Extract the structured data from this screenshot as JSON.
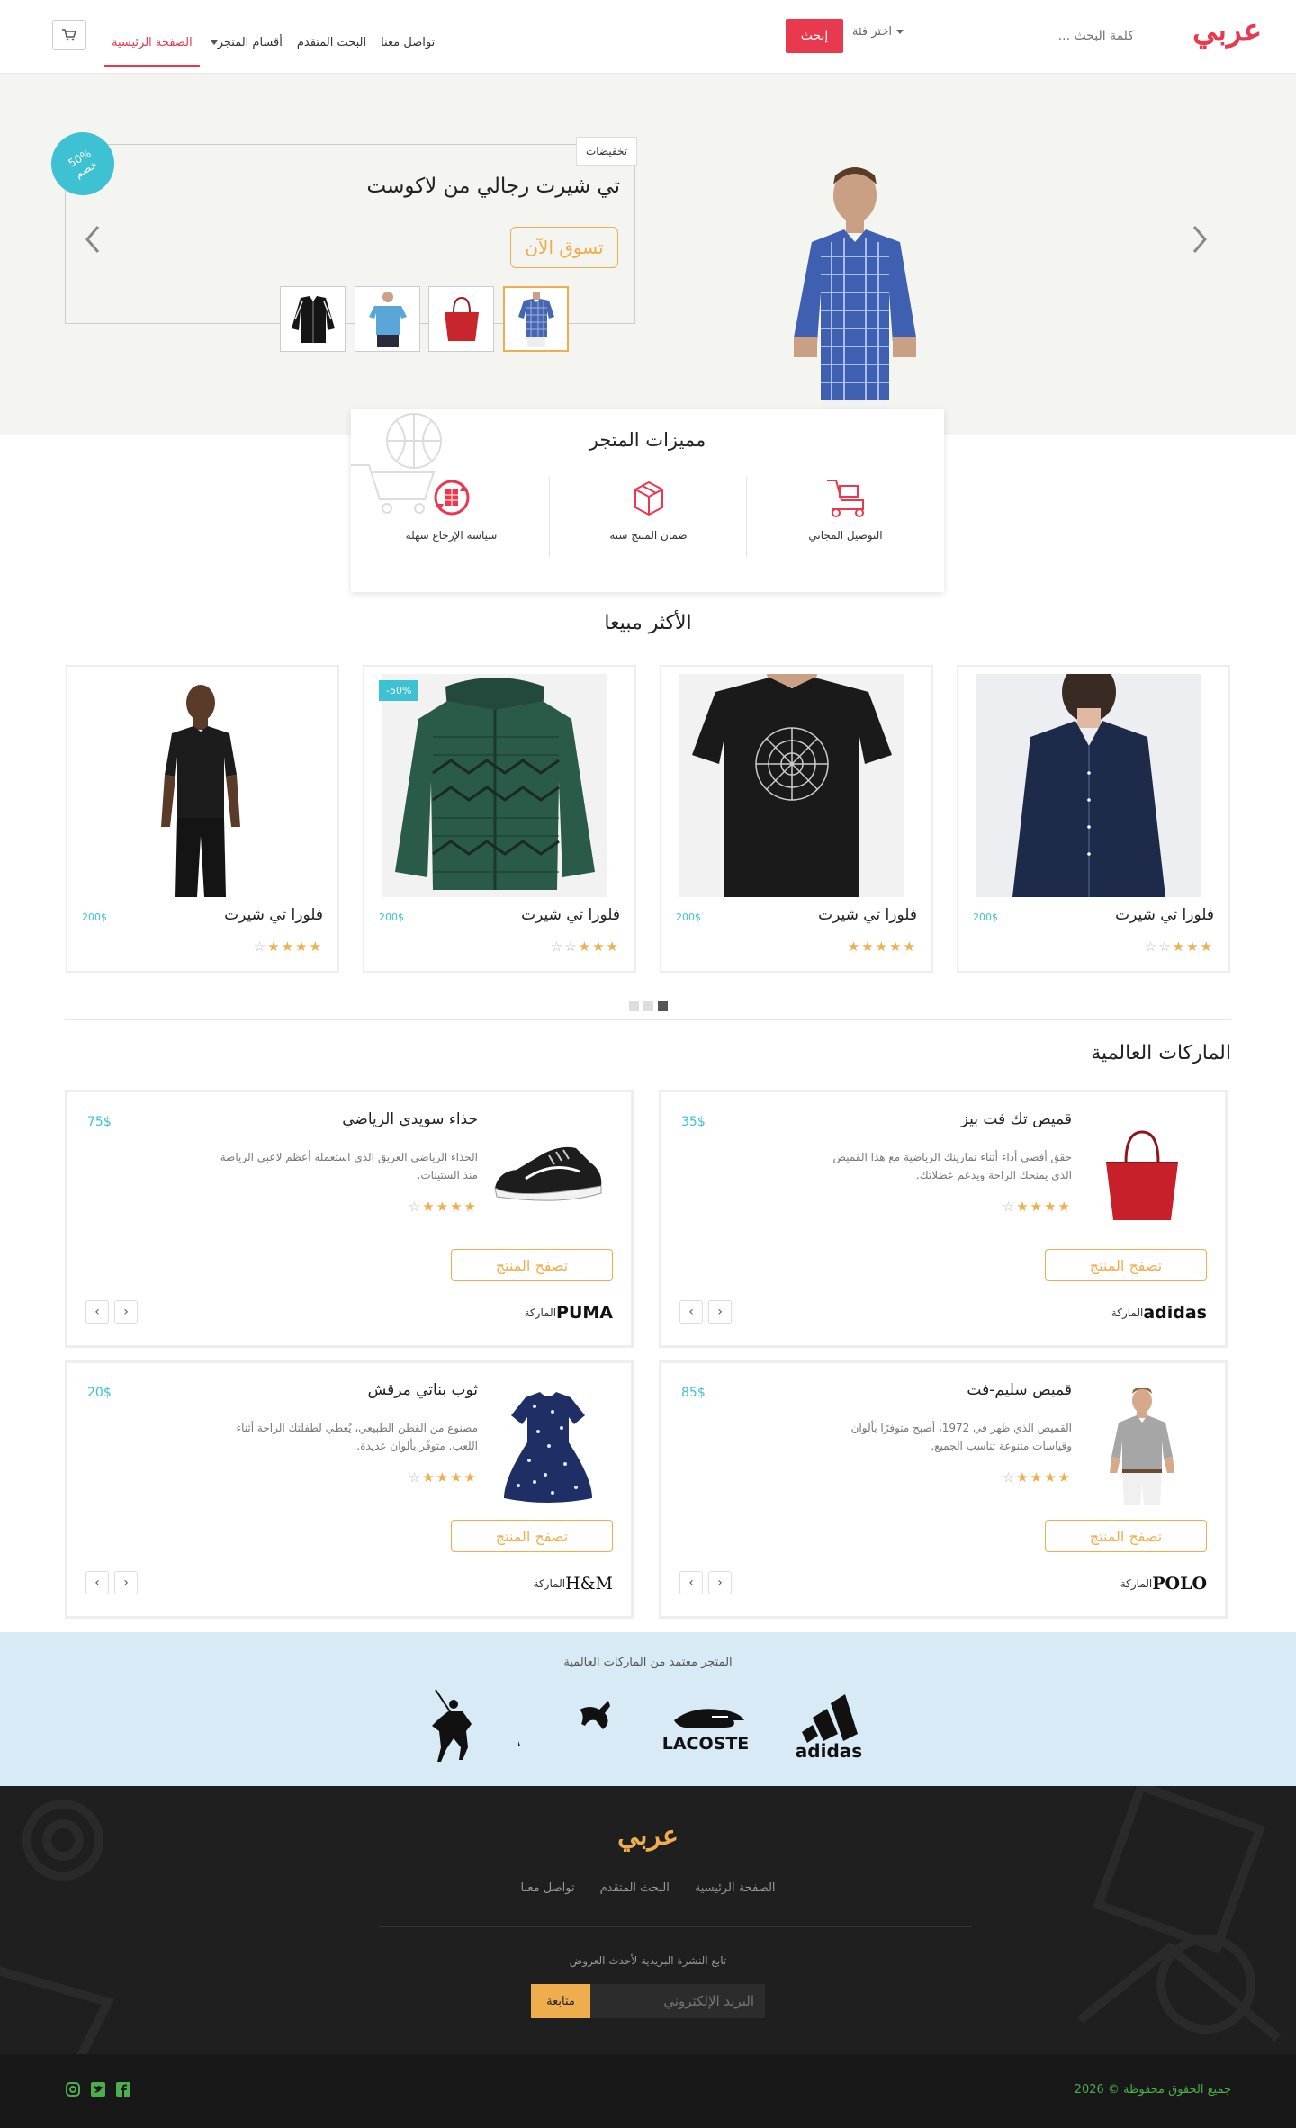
{
  "header": {
    "logo": "عربي",
    "search_placeholder": "كلمة البحث ...",
    "category_select": "اختر فئة",
    "search_button": "إبحث",
    "nav": [
      {
        "label": "الصفحة الرئيسية",
        "active": true
      },
      {
        "label": "أقسام المتجر",
        "dropdown": true
      },
      {
        "label": "البحث المتقدم"
      },
      {
        "label": "تواصل معنا"
      }
    ],
    "cart_icon": "cart-icon"
  },
  "hero": {
    "tag": "تخفيضات",
    "title": "تي شيرت رجالي من لاكوست",
    "button": "تسوق الآن",
    "badge_line1": "50%",
    "badge_line2": "خصم",
    "thumbnails": [
      "blue-shirt",
      "red-bag",
      "blue-tshirt",
      "black-jacket"
    ],
    "active_thumbnail": 0
  },
  "features": {
    "title": "مميزات المتجر",
    "items": [
      {
        "label": "التوصيل المجاني",
        "icon": "delivery-icon"
      },
      {
        "label": "ضمان المنتج سنة",
        "icon": "box-icon"
      },
      {
        "label": "سياسة الإرجاع سهلة",
        "icon": "return-icon"
      }
    ],
    "accent": "#e8394e"
  },
  "best_selling": {
    "title": "الأكثر مبيعا",
    "products": [
      {
        "name": "فلورا تي شيرت",
        "price": "200$",
        "rating": 3,
        "image": "navy-blouse"
      },
      {
        "name": "فلورا تي شيرت",
        "price": "200$",
        "rating": 5,
        "image": "black-print-tshirt"
      },
      {
        "name": "فلورا تي شيرت",
        "price": "200$",
        "rating": 3,
        "image": "green-jacket",
        "badge": "50%-"
      },
      {
        "name": "فلورا تي شيرت",
        "price": "200$",
        "rating": 4,
        "image": "black-tshirt-model"
      }
    ],
    "pager": {
      "pages": 3,
      "active": 0
    }
  },
  "brands": {
    "title": "الماركات العالمية",
    "brand_label": "الماركة",
    "button": "تصفح المنتج",
    "products": [
      {
        "name": "قميص تك فت بيز",
        "price": "35$",
        "desc": "حقق أقصى أداء أثناء تمارينك الرياضية مع هذا القميص الذي يمنحك الراحة ويدعم عضلاتك.",
        "rating": 4,
        "brand": "adidas",
        "image": "red-bag"
      },
      {
        "name": "حذاء سويدي الرياضي",
        "price": "75$",
        "desc": "الحذاء الرياضي العريق الذي استعمله أعظم لاعبي الرياضة منذ الستينات.",
        "rating": 4,
        "brand": "PUMA",
        "image": "black-sneaker"
      },
      {
        "name": "قميص سليم-فت",
        "price": "85$",
        "desc": "القميص الذي ظهر في 1972، أصبح متوفرًا بألوان وقياسات متنوعة تناسب الجميع.",
        "rating": 4,
        "brand": "POLO",
        "image": "polo-shirt-model"
      },
      {
        "name": "ثوب بناتي مرقش",
        "price": "20$",
        "desc": "مصنوع من القطن الطبيعي، يُعطي لطفلتك الراحة أثناء اللعب. متوفّر بألوان عديدة.",
        "rating": 4,
        "brand": "H&M",
        "image": "girls-dress"
      }
    ]
  },
  "partners": {
    "label": "المتجر معتمد من الماركات العالمية",
    "logos": [
      "adidas",
      "LACOSTE",
      "PUMA",
      "polo-ralph-lauren"
    ]
  },
  "footer": {
    "logo": "عربي",
    "links": [
      "الصفحة الرئيسية",
      "البحث المتقدم",
      "تواصل معنا"
    ],
    "newsletter_label": "تابع النشرة البريدية لأحدث العروض",
    "email_placeholder": "البريد الإلكتروني",
    "subscribe_button": "متابعة",
    "copyright": "جميع الحقوق محفوظة © 2026",
    "social": [
      "facebook-icon",
      "twitter-icon",
      "instagram-icon"
    ]
  },
  "colors": {
    "accent": "#e8394e",
    "gold": "#f0ad4e",
    "teal": "#3ec1d3",
    "partners_bg": "#d9eaf7",
    "footer_bg": "#1f1f1f"
  }
}
